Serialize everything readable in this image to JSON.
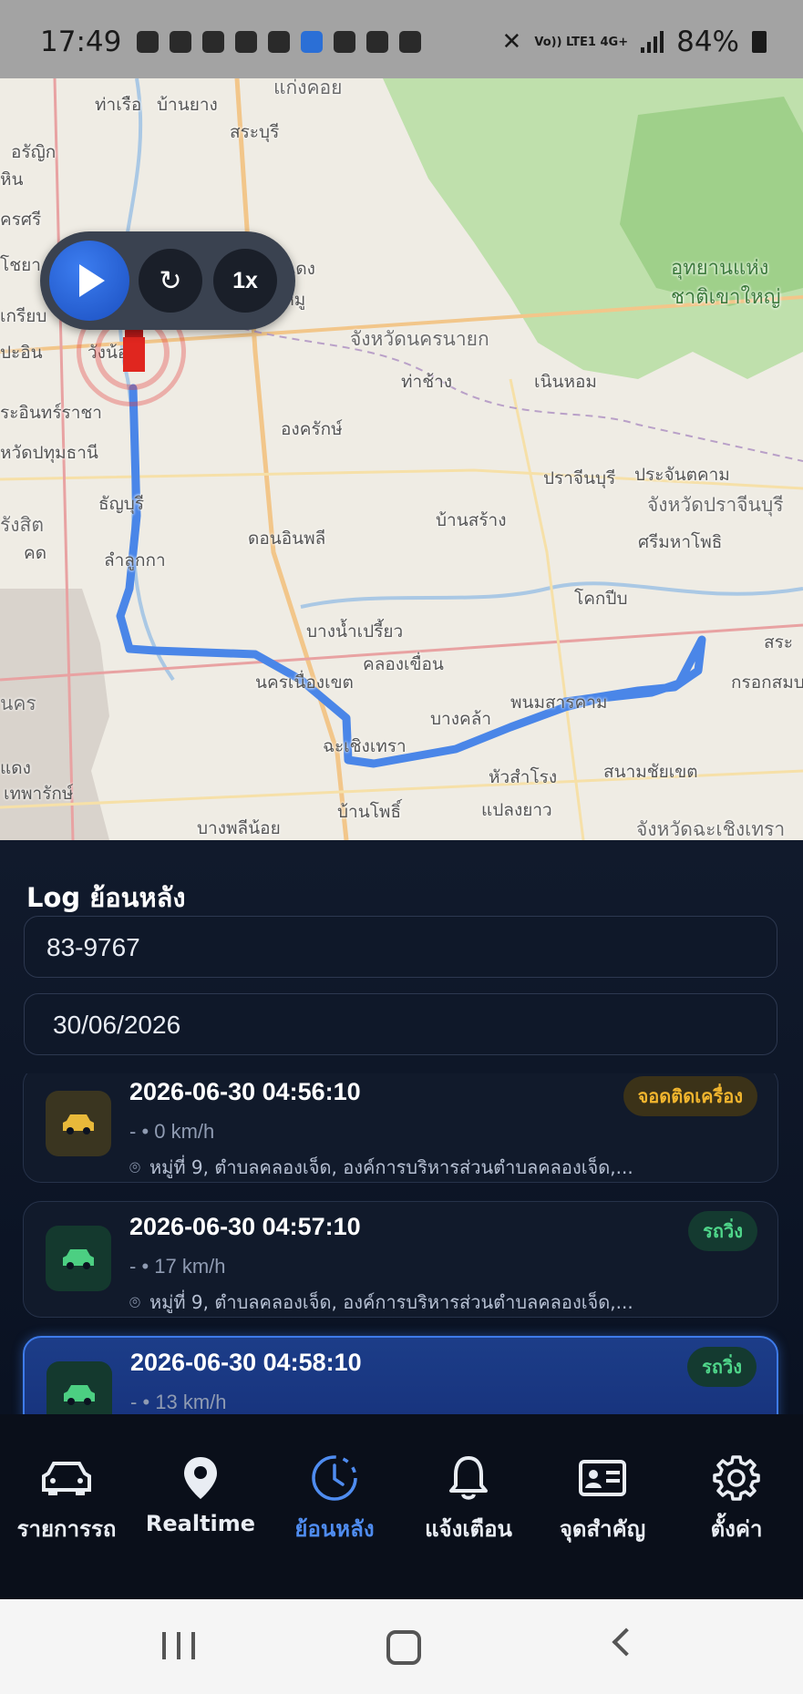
{
  "status_bar": {
    "time": "17:49",
    "battery": "84%",
    "network": "Vo)) LTE1 4G+",
    "icons": [
      "line-icon",
      "messenger-icon",
      "shopee-icon",
      "l-icon",
      "shield-icon",
      "home-icon",
      "arc-icon",
      "image-icon",
      "dots-icon",
      "mute-icon",
      "signal-icon",
      "battery-icon"
    ]
  },
  "map": {
    "labels": [
      {
        "text": "แก่งคอย",
        "cls": "big"
      },
      {
        "text": "ท่าเรือ",
        "cls": ""
      },
      {
        "text": "บ้านยาง",
        "cls": ""
      },
      {
        "text": "สระบุรี",
        "cls": ""
      },
      {
        "text": "อรัญิก",
        "cls": ""
      },
      {
        "text": "หิน",
        "cls": ""
      },
      {
        "text": "ครศรี",
        "cls": ""
      },
      {
        "text": "โชยา",
        "cls": ""
      },
      {
        "text": "วิหารแดง",
        "cls": ""
      },
      {
        "text": "หนองหมู",
        "cls": ""
      },
      {
        "text": "เกรียบ",
        "cls": ""
      },
      {
        "text": "ปะอิน",
        "cls": ""
      },
      {
        "text": "วังน้อย",
        "cls": ""
      },
      {
        "text": "จังหวัดนครนายก",
        "cls": "big"
      },
      {
        "text": "ท่าช้าง",
        "cls": ""
      },
      {
        "text": "เนินหอม",
        "cls": ""
      },
      {
        "text": "ระอินทร์ราชา",
        "cls": ""
      },
      {
        "text": "องครักษ์",
        "cls": ""
      },
      {
        "text": "หวัดปทุมธานี",
        "cls": ""
      },
      {
        "text": "ปราจีนบุรี",
        "cls": ""
      },
      {
        "text": "ประจันตคาม",
        "cls": ""
      },
      {
        "text": "จังหวัดปราจีนบุรี",
        "cls": "big"
      },
      {
        "text": "ธัญบุรี",
        "cls": ""
      },
      {
        "text": "บ้านสร้าง",
        "cls": ""
      },
      {
        "text": "รังสิต",
        "cls": "big"
      },
      {
        "text": "ดอนอินพลี",
        "cls": ""
      },
      {
        "text": "ศรีมหาโพธิ",
        "cls": ""
      },
      {
        "text": "คด",
        "cls": ""
      },
      {
        "text": "ลำลูกกา",
        "cls": ""
      },
      {
        "text": "โคกปีบ",
        "cls": ""
      },
      {
        "text": "บางน้ำเปรี้ยว",
        "cls": ""
      },
      {
        "text": "สระ",
        "cls": ""
      },
      {
        "text": "คลองเขื่อน",
        "cls": ""
      },
      {
        "text": "นครเนื่องเขต",
        "cls": ""
      },
      {
        "text": "กรอกสมบ",
        "cls": ""
      },
      {
        "text": "นคร",
        "cls": "big"
      },
      {
        "text": "พนมสารคาม",
        "cls": ""
      },
      {
        "text": "บางคล้า",
        "cls": ""
      },
      {
        "text": "ฉะเชิงเทรา",
        "cls": ""
      },
      {
        "text": "แดง",
        "cls": ""
      },
      {
        "text": "สนามชัยเขต",
        "cls": ""
      },
      {
        "text": "เทพารักษ์",
        "cls": ""
      },
      {
        "text": "หัวสำโรง",
        "cls": ""
      },
      {
        "text": "บ้านโพธิ์",
        "cls": ""
      },
      {
        "text": "แปลงยาว",
        "cls": ""
      },
      {
        "text": "บางพลีน้อย",
        "cls": ""
      },
      {
        "text": "จังหวัดฉะเชิงเทรา",
        "cls": "big"
      },
      {
        "text": "อุทยานแห่ง",
        "cls": "park"
      },
      {
        "text": "ชาติเขาใหญ่",
        "cls": "park"
      }
    ]
  },
  "player": {
    "play_icon": "play-icon",
    "restart_icon": "restart-icon",
    "speed_label": "1x"
  },
  "sheet": {
    "title": "Log ย้อนหลัง",
    "vehicle_value": "83-9767",
    "date_value": "30/06/2026"
  },
  "logs": [
    {
      "time": "2026-06-30 04:56:10",
      "speed": "- • 0 km/h",
      "address": "หมู่ที่ 9, ตำบลคลองเจ็ด, องค์การบริหารส่วนตำบลคลองเจ็ด,...",
      "status": "จอดติดเครื่อง",
      "tone": "yellow",
      "active": false
    },
    {
      "time": "2026-06-30 04:57:10",
      "speed": "- • 17 km/h",
      "address": "หมู่ที่ 9, ตำบลคลองเจ็ด, องค์การบริหารส่วนตำบลคลองเจ็ด,...",
      "status": "รถวิ่ง",
      "tone": "green",
      "active": false
    },
    {
      "time": "2026-06-30 04:58:10",
      "speed": "- • 13 km/h",
      "address": "",
      "status": "รถวิ่ง",
      "tone": "green",
      "active": true
    }
  ],
  "nav": {
    "items": [
      {
        "label": "รายการรถ",
        "icon": "car-icon",
        "active": false
      },
      {
        "label": "Realtime",
        "icon": "location-pin-icon",
        "active": false
      },
      {
        "label": "ย้อนหลัง",
        "icon": "history-clock-icon",
        "active": true
      },
      {
        "label": "แจ้งเตือน",
        "icon": "bell-icon",
        "active": false
      },
      {
        "label": "จุดสำคัญ",
        "icon": "id-card-icon",
        "active": false
      },
      {
        "label": "ตั้งค่า",
        "icon": "gear-icon",
        "active": false
      }
    ]
  },
  "colors": {
    "accent": "#4f8cf0",
    "route": "#4a86e8",
    "badge_yellow": "#f1b52e",
    "badge_green": "#4fd68a",
    "sheet_bg": "#0b1220"
  }
}
